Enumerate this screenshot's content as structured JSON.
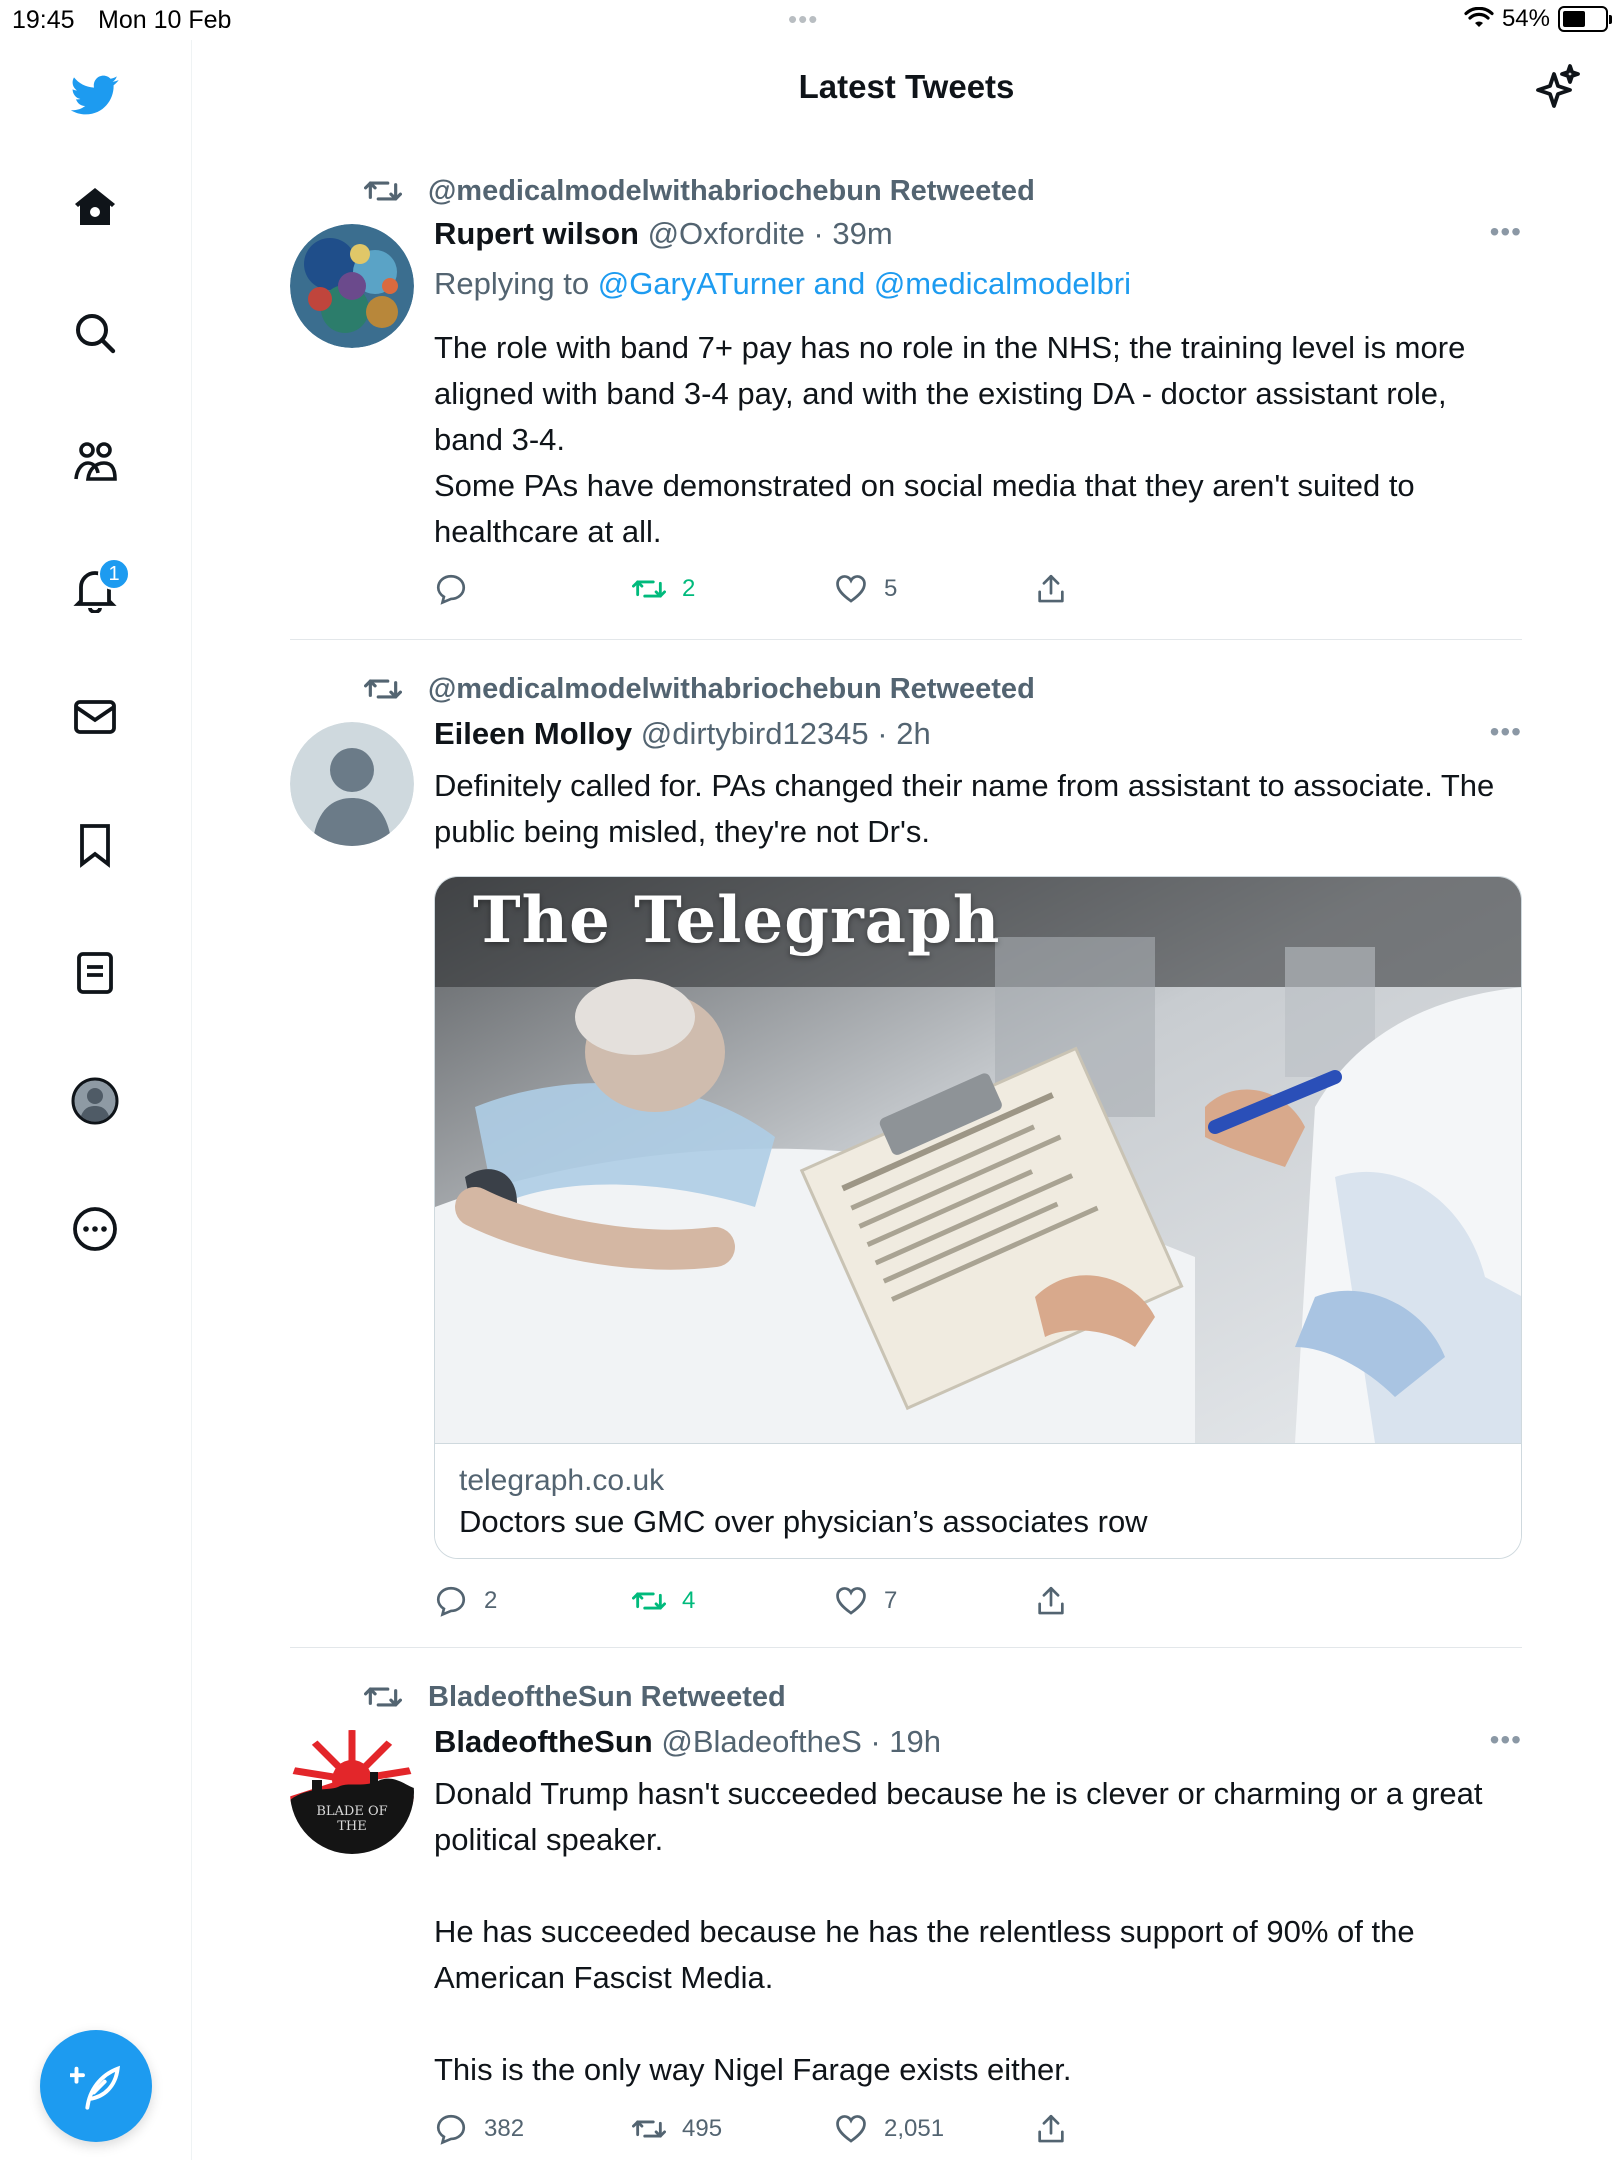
{
  "status_bar": {
    "time": "19:45",
    "date": "Mon 10 Feb",
    "battery": "54%",
    "battery_level": 0.54
  },
  "header": {
    "title": "Latest Tweets"
  },
  "sidebar": {
    "notifications_badge": "1",
    "icons": [
      "twitter-logo-icon",
      "home-icon",
      "search-icon",
      "communities-icon",
      "notifications-icon",
      "messages-icon",
      "bookmarks-icon",
      "lists-icon",
      "profile-icon",
      "more-icon"
    ]
  },
  "tweets": [
    {
      "retweeted_by": "@medicalmodelwithabriochebun Retweeted",
      "name": "Rupert wilson",
      "meta": "@Oxfordite · 39m",
      "reply_prefix": "Replying to ",
      "reply_targets": "@GaryATurner and @medicalmodelbri",
      "text": [
        "The role with band 7+ pay has no role in the NHS; the training level is more aligned with band 3-4 pay, and with the existing DA - doctor assistant role, band 3-4.",
        "Some PAs have demonstrated on social media that they aren't suited to healthcare at all."
      ],
      "replies": "",
      "retweets": "2",
      "likes": "5"
    },
    {
      "retweeted_by": "@medicalmodelwithabriochebun Retweeted",
      "name": "Eileen Molloy",
      "meta": "@dirtybird12345 · 2h",
      "text": [
        "Definitely called for. PAs changed their name from assistant to associate. The public being misled, they're not Dr's."
      ],
      "card": {
        "masthead": "The Telegraph",
        "domain": "telegraph.co.uk",
        "title": "Doctors sue GMC over physician’s associates row"
      },
      "replies": "2",
      "retweets": "4",
      "likes": "7"
    },
    {
      "retweeted_by": "BladeoftheSun Retweeted",
      "name": "BladeoftheSun",
      "meta": "@BladeoftheS · 19h",
      "avatar_text": "BLADE OF THE",
      "text": [
        "Donald Trump hasn't succeeded because he is clever or charming or a great political speaker.",
        "He has succeeded because he has the relentless support of 90% of the American Fascist Media.",
        "This is the only way Nigel Farage exists either."
      ],
      "replies": "382",
      "retweets": "495",
      "likes": "2,051"
    }
  ],
  "colors": {
    "accent": "#1d9bf0",
    "retweet_green": "#00ba7c",
    "secondary_text": "#536471"
  }
}
